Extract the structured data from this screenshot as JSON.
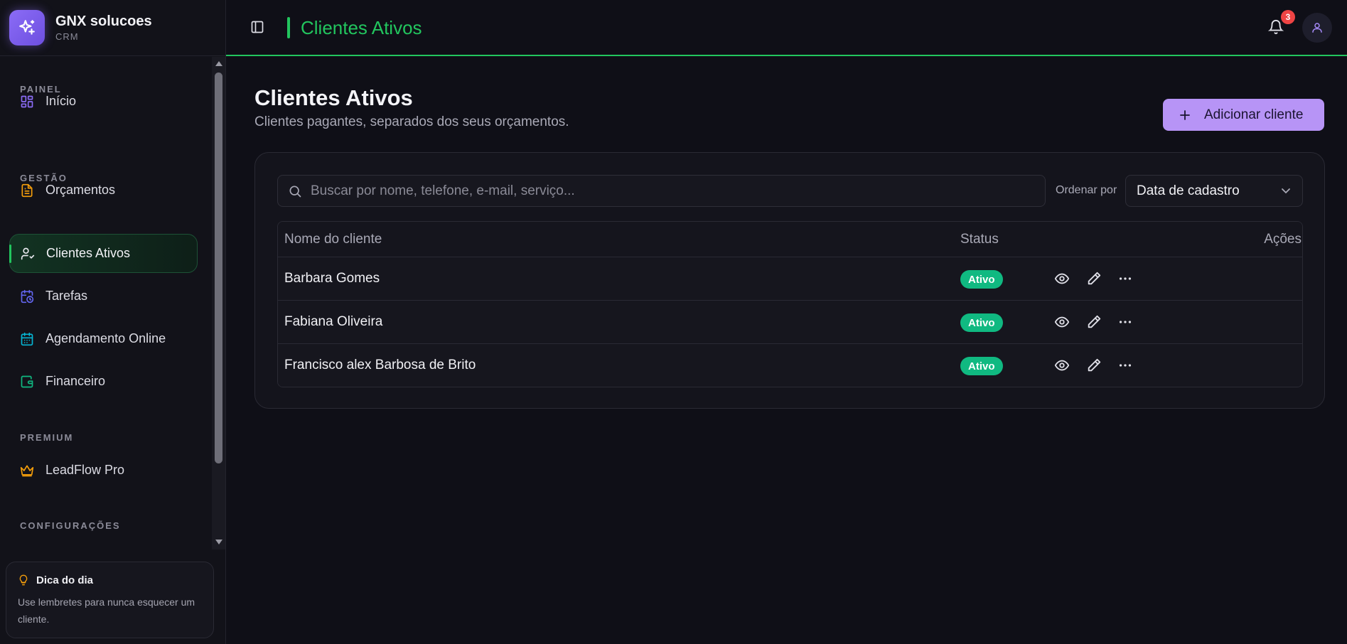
{
  "brand": {
    "name": "GNX solucoes",
    "subtitle": "CRM"
  },
  "sidebar": {
    "sections": [
      "PAINEL",
      "GESTÃO",
      "PREMIUM",
      "CONFIGURAÇÕES"
    ],
    "items": [
      {
        "label": "Início",
        "icon": "dashboard-icon"
      },
      {
        "label": "Orçamentos",
        "icon": "document-icon"
      },
      {
        "label": "Clientes Ativos",
        "icon": "user-check-icon",
        "active": true
      },
      {
        "label": "Tarefas",
        "icon": "calendar-clock-icon"
      },
      {
        "label": "Agendamento Online",
        "icon": "calendar-icon"
      },
      {
        "label": "Financeiro",
        "icon": "wallet-icon"
      },
      {
        "label": "LeadFlow Pro",
        "icon": "crown-icon"
      }
    ]
  },
  "tip": {
    "title": "Dica do dia",
    "text": "Use lembretes para nunca esquecer um cliente."
  },
  "header": {
    "title": "Clientes Ativos",
    "notification_count": "3"
  },
  "main": {
    "title": "Clientes Ativos",
    "subtitle": "Clientes pagantes, separados dos seus orçamentos.",
    "add_button": "Adicionar cliente",
    "search_placeholder": "Buscar por nome, telefone, e-mail, serviço...",
    "sort_label": "Ordenar por",
    "sort_value": "Data de cadastro",
    "table": {
      "columns": [
        "Nome do cliente",
        "Status",
        "Ações"
      ],
      "rows": [
        {
          "name": "Barbara Gomes",
          "status": "Ativo"
        },
        {
          "name": "Fabiana Oliveira",
          "status": "Ativo"
        },
        {
          "name": "Francisco alex Barbosa de Brito",
          "status": "Ativo"
        }
      ]
    }
  },
  "colors": {
    "accent": "#22c55e",
    "primary": "#b794f6",
    "status_active": "#10b981",
    "badge": "#ef4444"
  }
}
